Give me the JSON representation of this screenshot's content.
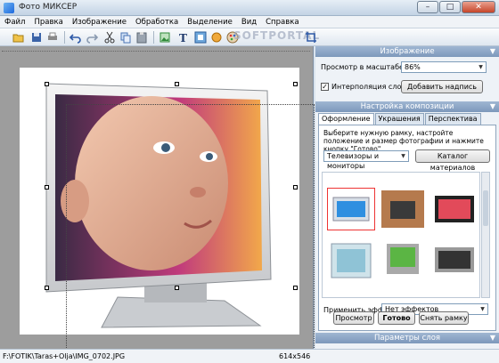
{
  "window": {
    "title": "Фото МИКСЕР"
  },
  "menu": [
    "Файл",
    "Правка",
    "Изображение",
    "Обработка",
    "Выделение",
    "Вид",
    "Справка"
  ],
  "watermark": "SOFTPORTAL",
  "status": {
    "path": "F:\\FOTIK\\Taras+Olja\\IMG_0702.JPG",
    "dims": "614x546"
  },
  "panel_image": {
    "header": "Изображение",
    "zoom_label": "Просмотр в масштабе",
    "zoom_value": "86%",
    "interp_label": "Интерполяция слоёв",
    "add_caption_button": "Добавить надпись"
  },
  "panel_composition": {
    "header": "Настройка композиции",
    "tabs": [
      "Оформление",
      "Украшения",
      "Перспектива"
    ],
    "description": "Выберите нужную рамку, настройте положение и размер фотографии и нажмите кнопку \"Готово\".",
    "category_value": "Телевизоры и мониторы",
    "catalog_button": "Каталог материалов",
    "effect_label": "Применить эффект",
    "effect_value": "Нет эффектов",
    "preview_button": "Просмотр",
    "done_button": "Готово",
    "remove_frame_button": "Снять рамку"
  },
  "panel_layer": {
    "header": "Параметры слоя"
  }
}
